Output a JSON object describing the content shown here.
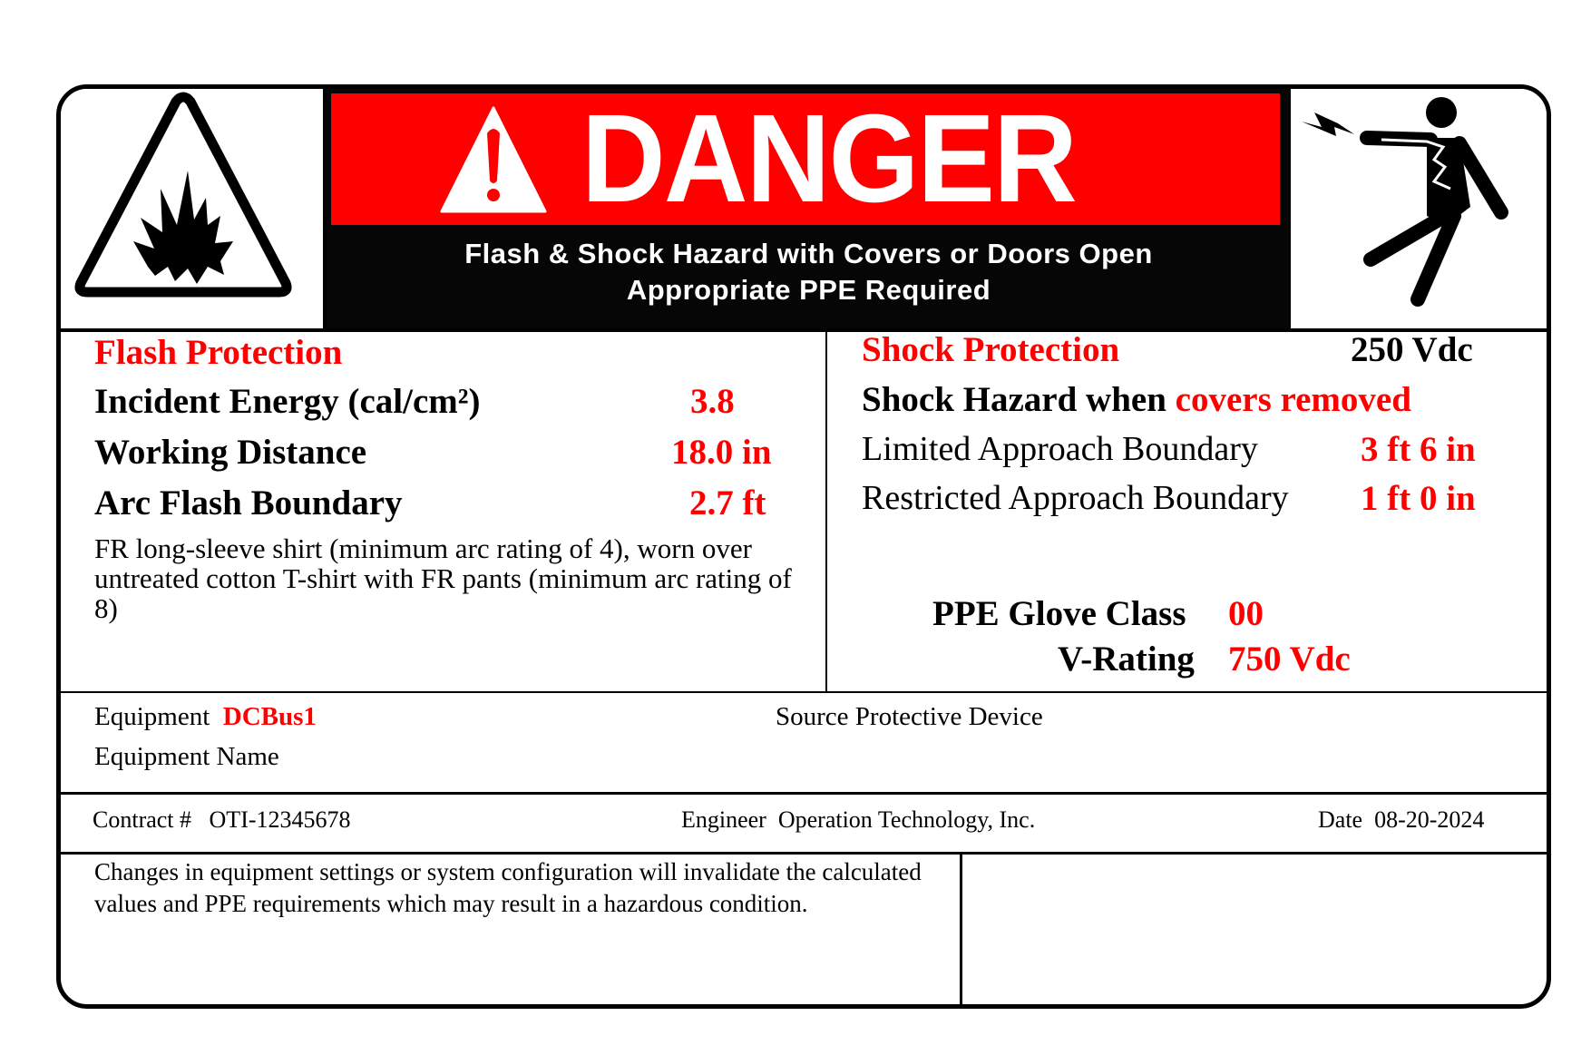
{
  "header": {
    "title": "DANGER",
    "subtitle_line1": "Flash & Shock Hazard with Covers or Doors Open",
    "subtitle_line2": "Appropriate PPE Required",
    "colors": {
      "danger_red": "#ff0000",
      "header_black": "#060606",
      "value_red": "#ff0000"
    },
    "icons": {
      "left": "arc-flash-explosion-warning-icon",
      "title": "exclamation-triangle-icon",
      "right": "electric-shock-person-icon"
    }
  },
  "flash_protection": {
    "heading": "Flash Protection",
    "rows": [
      {
        "label": "Incident Energy (cal/cm²)",
        "value": "3.8"
      },
      {
        "label": "Working Distance",
        "value": "18.0 in"
      },
      {
        "label": "Arc Flash Boundary",
        "value": "2.7 ft"
      }
    ],
    "ppe_description": "FR long-sleeve shirt (minimum arc rating of 4), worn over untreated cotton T-shirt with FR pants (minimum arc rating of 8)"
  },
  "shock_protection": {
    "heading": "Shock Protection",
    "voltage": "250 Vdc",
    "hazard_prefix": "Shock Hazard when ",
    "hazard_condition": "covers removed",
    "rows": [
      {
        "label": "Limited Approach Boundary",
        "value": "3 ft 6 in"
      },
      {
        "label": "Restricted Approach Boundary",
        "value": "1 ft 0 in"
      }
    ],
    "glove_class_label": "PPE Glove Class",
    "glove_class_value": "00",
    "v_rating_label": "V-Rating",
    "v_rating_value": "750 Vdc"
  },
  "equipment": {
    "equipment_label": "Equipment",
    "equipment_value": "DCBus1",
    "equipment_name_label": "Equipment Name",
    "equipment_name_value": "",
    "source_device_label": "Source Protective Device",
    "source_device_value": ""
  },
  "footer": {
    "contract_label": "Contract #",
    "contract_value": "OTI-12345678",
    "engineer_label": "Engineer",
    "engineer_value": "Operation Technology, Inc.",
    "date_label": "Date",
    "date_value": "08-20-2024",
    "note": "Changes in equipment settings or system configuration will invalidate the calculated values and PPE requirements which may result in a hazardous condition."
  }
}
